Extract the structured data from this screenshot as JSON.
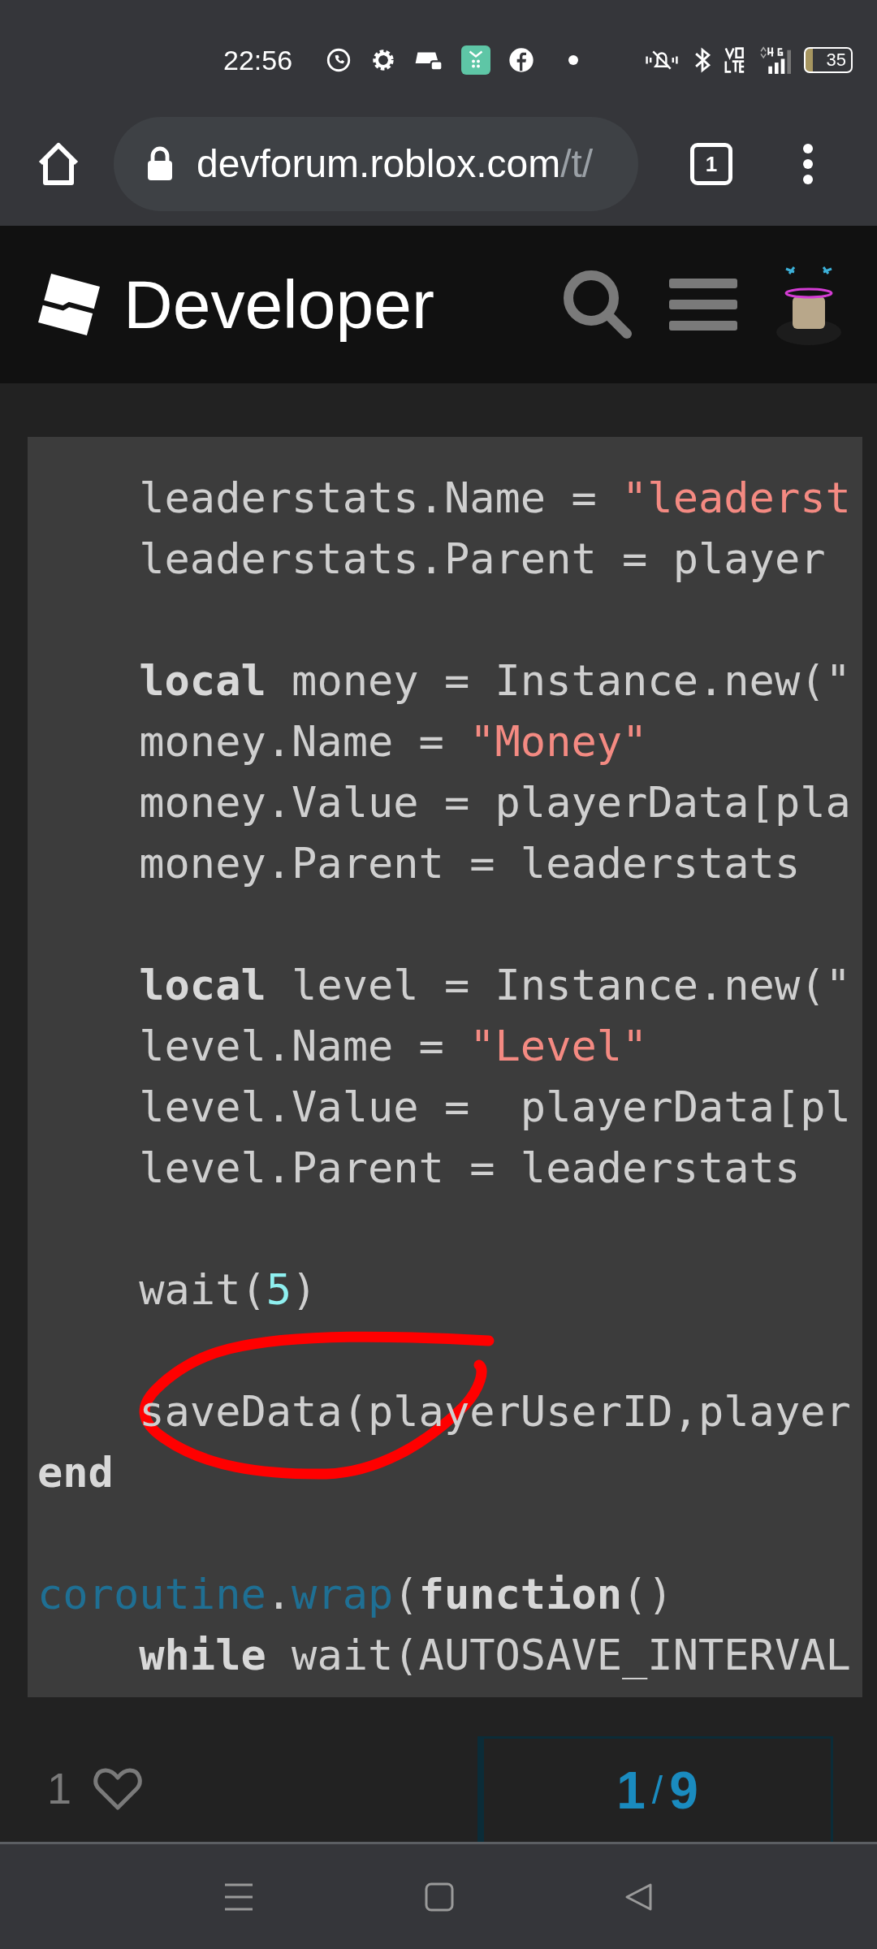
{
  "status_bar": {
    "time": "22:56",
    "battery": "35"
  },
  "browser": {
    "url_host": "devforum.roblox.com",
    "url_path": "/t/",
    "tab_count": "1"
  },
  "header": {
    "title": "Developer"
  },
  "code": [
    {
      "kind": "indented",
      "tokens": [
        {
          "text": "leaderstats.Name = ",
          "kind": "plain"
        },
        {
          "text": "\"leaderst",
          "kind": "string"
        }
      ]
    },
    {
      "kind": "indented",
      "tokens": [
        {
          "text": "leaderstats.Parent = player",
          "kind": "plain"
        }
      ]
    },
    {
      "kind": "blank"
    },
    {
      "kind": "indented",
      "tokens": [
        {
          "text": "local",
          "kind": "keyword"
        },
        {
          "text": " money = Instance.new(\"",
          "kind": "plain"
        }
      ]
    },
    {
      "kind": "indented",
      "tokens": [
        {
          "text": "money.Name = ",
          "kind": "plain"
        },
        {
          "text": "\"Money\"",
          "kind": "string"
        }
      ]
    },
    {
      "kind": "indented",
      "tokens": [
        {
          "text": "money.Value = playerData[pla",
          "kind": "plain"
        }
      ]
    },
    {
      "kind": "indented",
      "tokens": [
        {
          "text": "money.Parent = leaderstats",
          "kind": "plain"
        }
      ]
    },
    {
      "kind": "blank"
    },
    {
      "kind": "indented",
      "tokens": [
        {
          "text": "local",
          "kind": "keyword"
        },
        {
          "text": " level = Instance.new(\"",
          "kind": "plain"
        }
      ]
    },
    {
      "kind": "indented",
      "tokens": [
        {
          "text": "level.Name = ",
          "kind": "plain"
        },
        {
          "text": "\"Level\"",
          "kind": "string"
        }
      ]
    },
    {
      "kind": "indented",
      "tokens": [
        {
          "text": "level.Value =  playerData[pl",
          "kind": "plain"
        }
      ]
    },
    {
      "kind": "indented",
      "tokens": [
        {
          "text": "level.Parent = leaderstats",
          "kind": "plain"
        }
      ]
    },
    {
      "kind": "blank"
    },
    {
      "kind": "indented",
      "tokens": [
        {
          "text": "wait(",
          "kind": "plain"
        },
        {
          "text": "5",
          "kind": "number"
        },
        {
          "text": ")",
          "kind": "plain"
        }
      ]
    },
    {
      "kind": "blank"
    },
    {
      "kind": "indented",
      "tokens": [
        {
          "text": "saveData(playerUserID,player",
          "kind": "plain"
        }
      ]
    },
    {
      "kind": "top",
      "tokens": [
        {
          "text": "end",
          "kind": "keyword"
        }
      ]
    },
    {
      "kind": "blank"
    },
    {
      "kind": "top",
      "tokens": [
        {
          "text": "coroutine",
          "kind": "builtin"
        },
        {
          "text": ".",
          "kind": "plain"
        },
        {
          "text": "wrap",
          "kind": "builtin"
        },
        {
          "text": "(",
          "kind": "plain"
        },
        {
          "text": "function",
          "kind": "keyword"
        },
        {
          "text": "()",
          "kind": "plain"
        }
      ]
    },
    {
      "kind": "indented",
      "tokens": [
        {
          "text": "while",
          "kind": "keyword"
        },
        {
          "text": " wait(AUTOSAVE_INTERVAL",
          "kind": "plain"
        }
      ]
    }
  ],
  "footer": {
    "likes": "1",
    "progress": {
      "current": "1",
      "separator": "/",
      "total": "9"
    }
  }
}
